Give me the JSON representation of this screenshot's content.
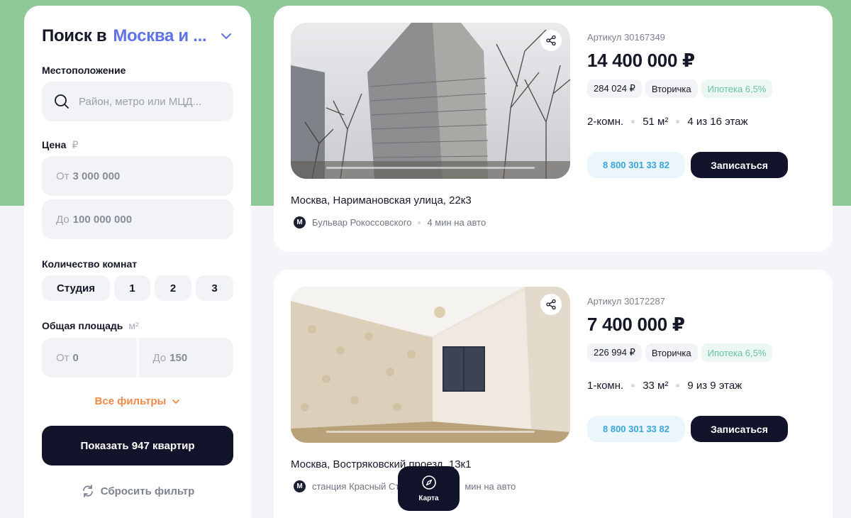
{
  "search": {
    "title": "Поиск в",
    "city": "Москва и ...",
    "location_label": "Местоположение",
    "location_placeholder": "Район, метро или МЦД...",
    "price_label": "Цена",
    "price_unit": "₽",
    "price_from_prefix": "От",
    "price_from": "3 000 000",
    "price_to_prefix": "До",
    "price_to": "100 000 000",
    "rooms_label": "Количество комнат",
    "rooms": [
      "Студия",
      "1",
      "2",
      "3"
    ],
    "area_label": "Общая площадь",
    "area_unit": "м²",
    "area_from_prefix": "От",
    "area_from": "0",
    "area_to_prefix": "До",
    "area_to": "150",
    "all_filters": "Все фильтры",
    "show_button": "Показать 947 квартир",
    "reset": "Сбросить фильтр"
  },
  "listings": [
    {
      "article": "Артикул 30167349",
      "price": "14 400 000 ₽",
      "price_per_m2": "284 024 ₽",
      "type": "Вторичка",
      "mortgage": "Ипотека 6,5%",
      "rooms": "2-комн.",
      "area": "51 м²",
      "floor": "4 из 16 этаж",
      "phone": "8 800 301 33 82",
      "signup": "Записаться",
      "address": "Москва, Наримановская улица, 22к3",
      "metro_icon": "М",
      "metro": "Бульвар Рокоссовского",
      "travel": "4 мин на авто"
    },
    {
      "article": "Артикул 30172287",
      "price": "7 400 000 ₽",
      "price_per_m2": "226 994 ₽",
      "type": "Вторичка",
      "mortgage": "Ипотека 6,5%",
      "rooms": "1-комн.",
      "area": "33 м²",
      "floor": "9 из 9 этаж",
      "phone": "8 800 301 33 82",
      "signup": "Записаться",
      "address": "Москва, Востряковский проезд, 13к1",
      "metro_icon": "М",
      "metro": "станция Красный Ст",
      "travel": "мин на авто"
    }
  ],
  "map_button": "Карта",
  "colors": {
    "accent_blue": "#5f72e8",
    "accent_orange": "#f08a47",
    "dark": "#11142a",
    "green_bg": "#8fc997",
    "mortgage_green": "#66c4a4",
    "phone_blue": "#3aa5d9"
  }
}
